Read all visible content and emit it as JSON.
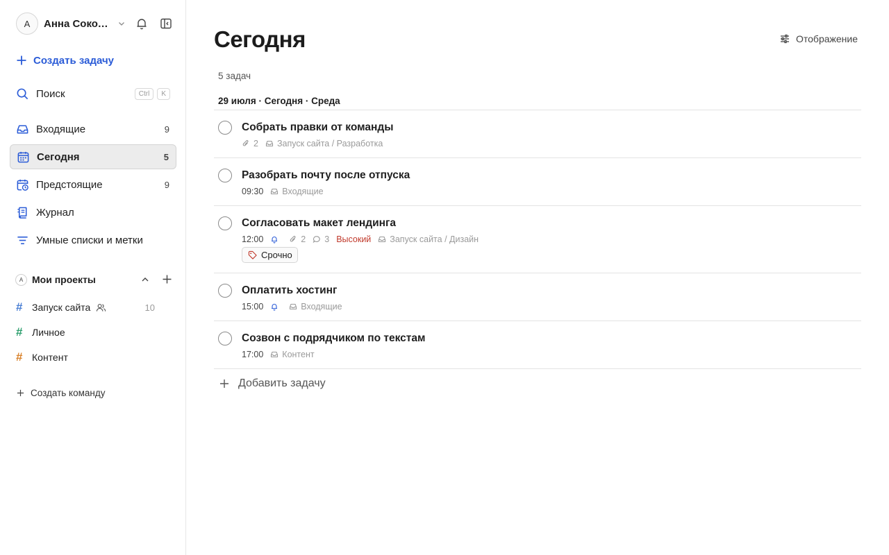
{
  "user": {
    "avatar_letter": "А",
    "name": "Анна Соколова"
  },
  "sidebar": {
    "create_task": "Создать задачу",
    "search": {
      "label": "Поиск",
      "kbd_ctrl": "Ctrl",
      "kbd_k": "K"
    },
    "nav": [
      {
        "label": "Входящие",
        "count": "9",
        "icon": "inbox-icon"
      },
      {
        "label": "Сегодня",
        "count": "5",
        "icon": "calendar-today-icon",
        "active": true
      },
      {
        "label": "Предстоящие",
        "count": "9",
        "icon": "calendar-upcoming-icon"
      },
      {
        "label": "Журнал",
        "count": "",
        "icon": "journal-icon"
      },
      {
        "label": "Умные списки и метки",
        "count": "",
        "icon": "filter-icon"
      }
    ],
    "projects_section": {
      "avatar_letter": "А",
      "title": "Мои проекты",
      "items": [
        {
          "label": "Запуск сайта",
          "count": "10",
          "color": "#4a7fd4",
          "shared": true
        },
        {
          "label": "Личное",
          "count": "",
          "color": "#2e9f6e"
        },
        {
          "label": "Контент",
          "count": "",
          "color": "#d9822b"
        }
      ]
    },
    "create_team": "Создать команду"
  },
  "main": {
    "title": "Сегодня",
    "view_button": "Отображение",
    "task_count": "5 задач",
    "date_header": "29 июля · Сегодня · Среда",
    "tasks": [
      {
        "title": "Собрать правки от команды",
        "attachments": "2",
        "project": "Запуск сайта / Разработка"
      },
      {
        "title": "Разобрать почту после отпуска",
        "time": "09:30",
        "project": "Входящие"
      },
      {
        "title": "Согласовать макет лендинга",
        "time": "12:00",
        "attachments": "2",
        "comments": "3",
        "priority": "Высокий",
        "project": "Запуск сайта / Дизайн",
        "tag": "Срочно"
      },
      {
        "title": "Оплатить хостинг",
        "time": "15:00",
        "project": "Входящие"
      },
      {
        "title": "Созвон с подрядчиком по текстам",
        "time": "17:00",
        "project": "Контент"
      }
    ],
    "add_task": "Добавить задачу"
  },
  "colors": {
    "accent": "#2a5bd7",
    "priority_high": "#c0392b",
    "bell": "#2a5bd7"
  }
}
